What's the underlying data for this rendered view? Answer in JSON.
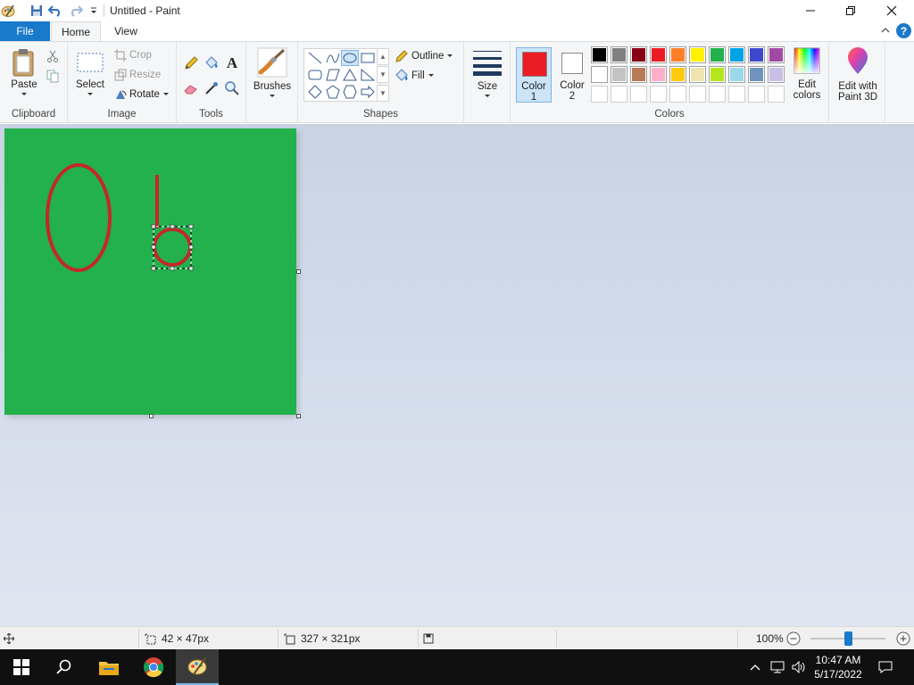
{
  "window": {
    "title": "Untitled - Paint"
  },
  "tabs": {
    "file": "File",
    "home": "Home",
    "view": "View"
  },
  "ribbon": {
    "clipboard": {
      "paste": "Paste",
      "group": "Clipboard"
    },
    "image": {
      "select": "Select",
      "crop": "Crop",
      "resize": "Resize",
      "rotate": "Rotate",
      "group": "Image"
    },
    "tools": {
      "group": "Tools"
    },
    "brushes": {
      "label": "Brushes"
    },
    "shapes": {
      "outline": "Outline",
      "fill": "Fill",
      "group": "Shapes"
    },
    "size": {
      "label": "Size"
    },
    "colors": {
      "color1_label": "Color",
      "color1_num": "1",
      "color2_label": "Color",
      "color2_num": "2",
      "edit_line1": "Edit",
      "edit_line2": "colors",
      "group": "Colors",
      "color1": "#ec1c24",
      "color2": "#ffffff",
      "palette_row1": [
        "#000000",
        "#7f7f7f",
        "#880015",
        "#ed1c24",
        "#ff7f27",
        "#fff200",
        "#22b14c",
        "#00a2e8",
        "#3f48cc",
        "#a349a4"
      ],
      "palette_row2": [
        "#ffffff",
        "#c3c3c3",
        "#b97a57",
        "#ffaec9",
        "#ffc90e",
        "#efe4b0",
        "#b5e61d",
        "#99d9ea",
        "#7092be",
        "#c8bfe7"
      ]
    },
    "paint3d": {
      "line1": "Edit with",
      "line2": "Paint 3D"
    }
  },
  "canvas": {
    "background": "#22b14c",
    "stroke_color": "#c3282a"
  },
  "statusbar": {
    "selection_size": "42 × 47px",
    "image_size": "327 × 321px",
    "zoom": "100%"
  },
  "taskbar": {
    "time": "10:47 AM",
    "date": "5/17/2022"
  }
}
